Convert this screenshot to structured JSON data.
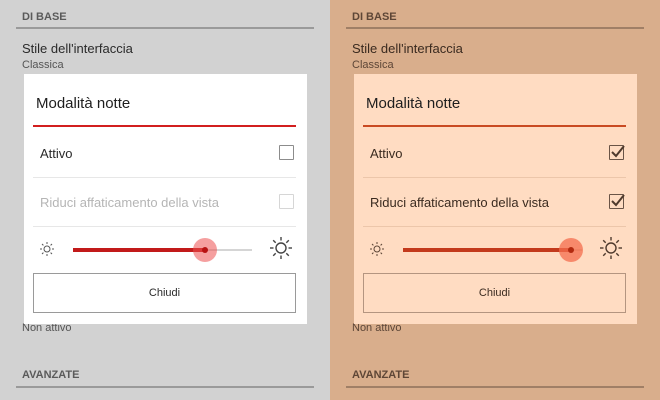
{
  "panels": [
    {
      "section_basic": "DI BASE",
      "interface_style": {
        "title": "Stile dell'interfaccia",
        "value": "Classica"
      },
      "dialog": {
        "title": "Modalità notte",
        "options": [
          {
            "label": "Attivo",
            "checked": false,
            "enabled": true
          },
          {
            "label": "Riduci affaticamento della vista",
            "checked": false,
            "enabled": false
          }
        ],
        "brightness_level": 0.74,
        "close_label": "Chiudi"
      },
      "status_text": "Non attivo",
      "section_advanced": "AVANZATE"
    },
    {
      "section_basic": "DI BASE",
      "interface_style": {
        "title": "Stile dell'interfaccia",
        "value": "Classica"
      },
      "dialog": {
        "title": "Modalità notte",
        "options": [
          {
            "label": "Attivo",
            "checked": true,
            "enabled": true
          },
          {
            "label": "Riduci affaticamento della vista",
            "checked": true,
            "enabled": true
          }
        ],
        "brightness_level": 0.94,
        "close_label": "Chiudi"
      },
      "status_text": "Non attivo",
      "section_advanced": "AVANZATE"
    }
  ],
  "colors": {
    "accent_red": "#c21a1a",
    "accent_orange": "#c33a1c",
    "bg_left": "#d2d2d2",
    "bg_right": "#d9ae8c"
  },
  "icons": {
    "brightness_low": "sun-small-icon",
    "brightness_high": "sun-large-icon",
    "checkmark": "check-icon"
  }
}
